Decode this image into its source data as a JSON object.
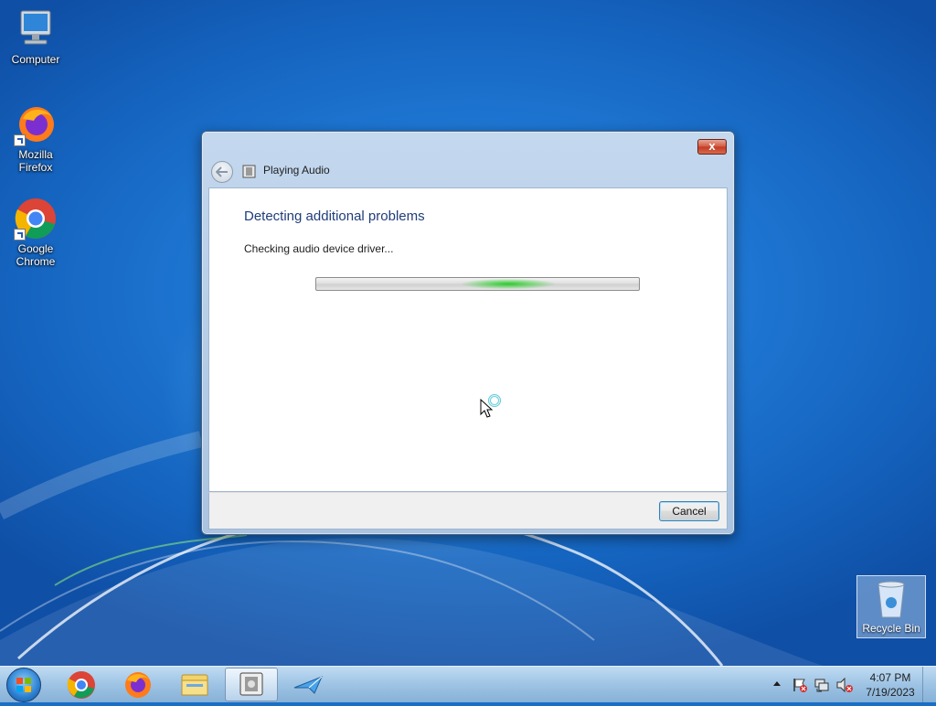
{
  "desktop": {
    "icons": [
      {
        "label": "Computer",
        "icon": "computer-icon"
      },
      {
        "label": "Mozilla Firefox",
        "icon": "firefox-icon"
      },
      {
        "label": "Google Chrome",
        "icon": "chrome-icon"
      }
    ],
    "recycle_bin": {
      "label": "Recycle Bin",
      "icon": "recycle-bin-icon"
    }
  },
  "dialog": {
    "title": "Playing Audio",
    "heading": "Detecting additional problems",
    "status": "Checking audio device driver...",
    "cancel_label": "Cancel",
    "close_glyph": "x",
    "progress_style": "indeterminate marquee"
  },
  "taskbar": {
    "items": [
      {
        "icon": "start-orb-icon"
      },
      {
        "icon": "chrome-icon"
      },
      {
        "icon": "firefox-icon"
      },
      {
        "icon": "file-explorer-icon"
      },
      {
        "icon": "troubleshooter-icon",
        "active": true
      },
      {
        "icon": "app-icon"
      }
    ],
    "clock": {
      "time": "4:07 PM",
      "date": "7/19/2023"
    },
    "tray_icons": [
      "show-hidden-icons-icon",
      "action-center-flag-icon",
      "network-icon",
      "volume-muted-icon"
    ]
  },
  "colors": {
    "heading": "#1f3d7a",
    "progress_glow": "#2fc82f",
    "desktop": "#1f78d4"
  }
}
